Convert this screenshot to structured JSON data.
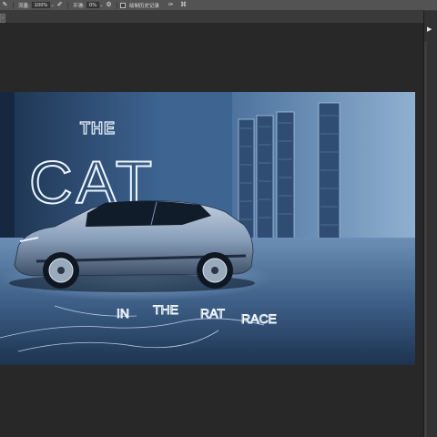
{
  "toolbar": {
    "flow_label": "流量:",
    "flow_value": "100%",
    "smooth_label": "平滑:",
    "smooth_value": "0%",
    "history_label": "绘制历史记录",
    "dropdown_glyph": "⌄"
  },
  "artwork": {
    "headline_the": "THE",
    "headline_cat": "CAT",
    "neon_words": [
      "IN",
      "THE",
      "RAT",
      "RACE"
    ]
  },
  "colors": {
    "ui_panel": "#535353",
    "ui_background": "#282828",
    "neon": "#e9f4ff",
    "scene_blue": "#3a5d86"
  },
  "icons": {
    "brush_tool": "brush-icon",
    "airbrush": "airbrush-icon",
    "settings": "gear-icon",
    "pressure": "pressure-icon",
    "butterfly": "symmetry-icon",
    "panel_toggle": "panel-expand-icon"
  }
}
